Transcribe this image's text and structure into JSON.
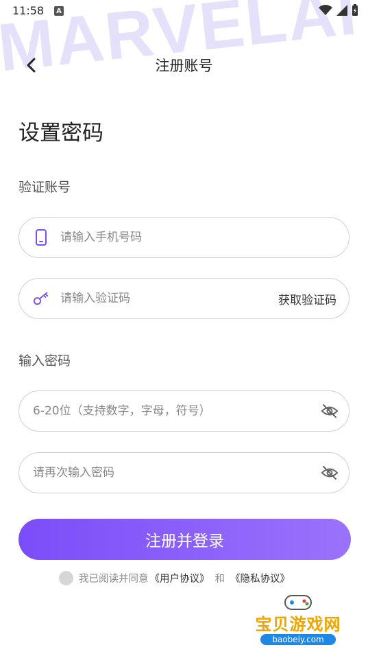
{
  "watermark": "MARVELAI",
  "status_bar": {
    "time": "11:58",
    "notification_letter": "A"
  },
  "header": {
    "title": "注册账号"
  },
  "page_title": "设置密码",
  "verify_section": {
    "label": "验证账号",
    "phone_placeholder": "请输入手机号码",
    "code_placeholder": "请输入验证码",
    "get_code_label": "获取验证码"
  },
  "password_section": {
    "label": "输入密码",
    "password_placeholder": "6-20位（支持数字，字母，符号）",
    "confirm_placeholder": "请再次输入密码"
  },
  "submit_label": "注册并登录",
  "agreement": {
    "prefix": "我已阅读并同意",
    "user_agreement": "《用户协议》",
    "and": "和",
    "privacy_agreement": "《隐私协议》"
  },
  "corner_logo": {
    "name": "宝贝游戏网",
    "url": "baobeiy.com"
  },
  "colors": {
    "accent": "#7b4dfa",
    "accent_light": "#9a72fb",
    "border": "#cfcfd6"
  }
}
